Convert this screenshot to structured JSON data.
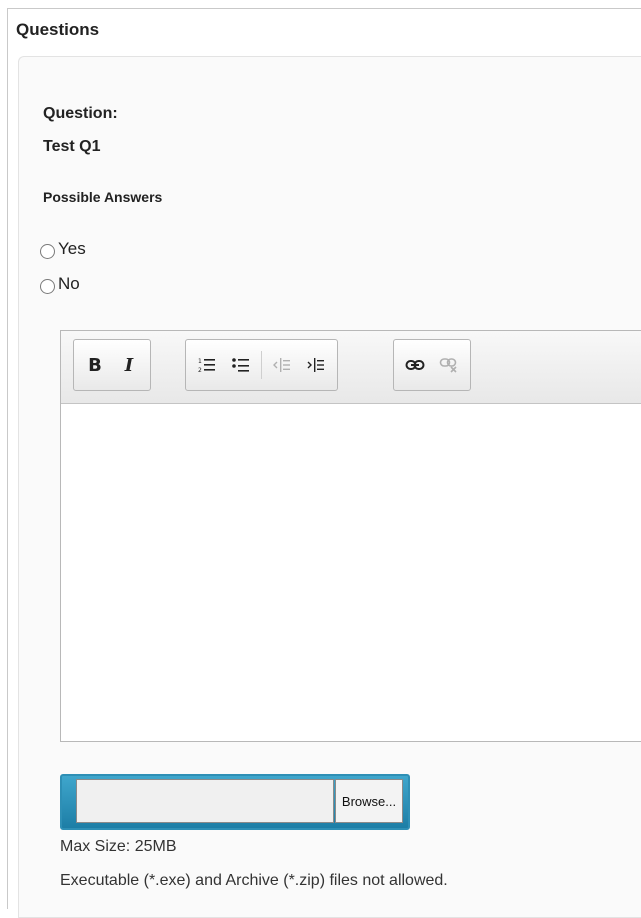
{
  "section": {
    "title": "Questions"
  },
  "question": {
    "label": "Question:",
    "text": "Test Q1"
  },
  "answers": {
    "heading": "Possible Answers",
    "options": [
      "Yes",
      "No"
    ]
  },
  "editor": {
    "toolbar": {
      "bold": "B",
      "italic": "I",
      "icons": [
        "bold-icon",
        "italic-icon",
        "numbered-list-icon",
        "bulleted-list-icon",
        "decrease-indent-icon",
        "increase-indent-icon",
        "link-icon",
        "unlink-icon"
      ]
    },
    "content": ""
  },
  "upload": {
    "browse_label": "Browse...",
    "max_size": "Max Size: 25MB",
    "restriction": "Executable (*.exe) and Archive (*.zip) files not allowed."
  },
  "colors": {
    "upload_border": "#2e8fb5",
    "disabled_icon": "#b0b0b0"
  }
}
